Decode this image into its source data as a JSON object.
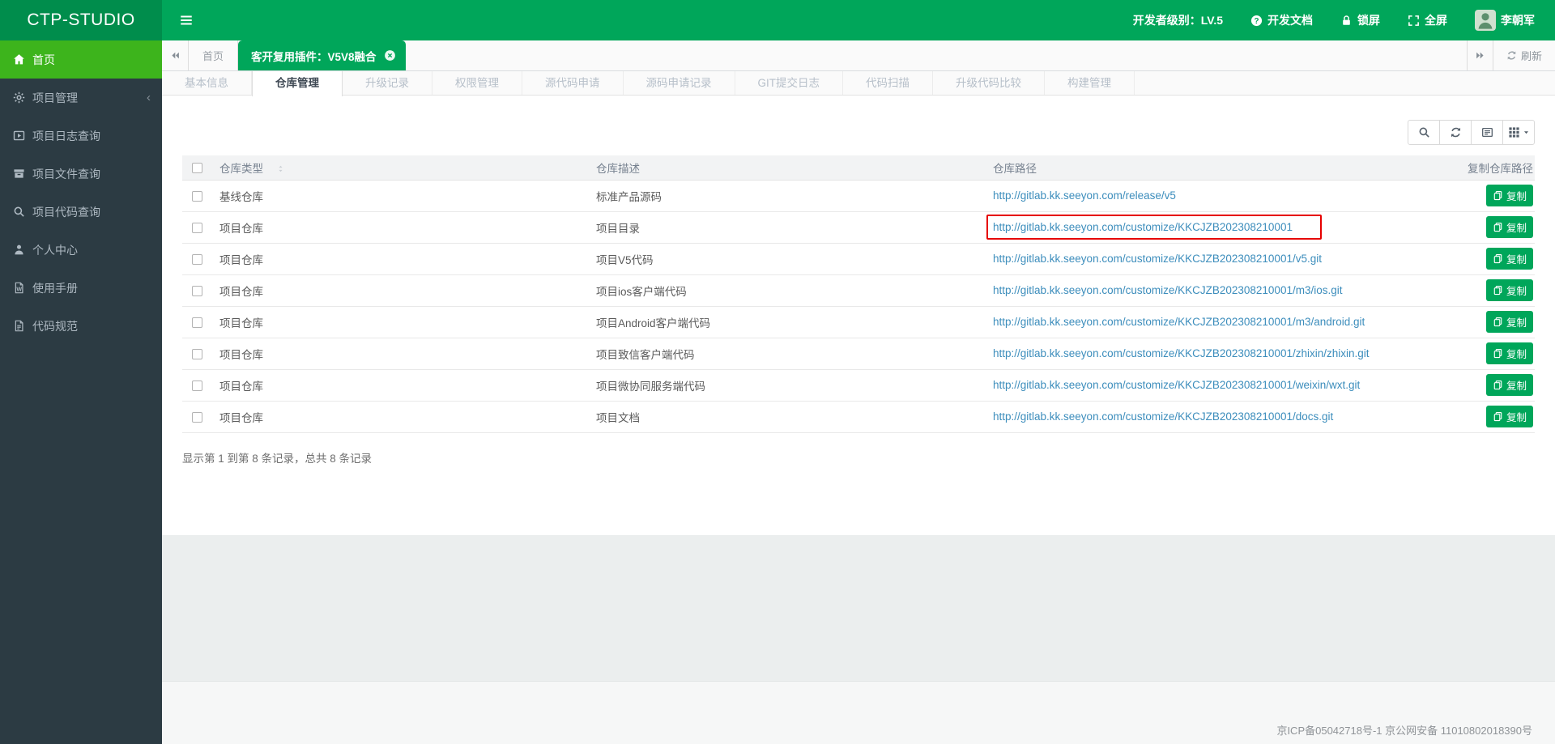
{
  "colors": {
    "primary": "#00a65a",
    "logo_bg": "#008d4c",
    "sidebar_bg": "#2c3b43",
    "sidebar_active": "#3db41c",
    "link": "#3c8dbc",
    "annotation": "#e60000"
  },
  "brand": {
    "title": "CTP-STUDIO"
  },
  "topbar": {
    "developer_level": "开发者级别：LV.5",
    "docs_label": "开发文档",
    "lock_label": "锁屏",
    "fullscreen_label": "全屏",
    "username": "李朝军"
  },
  "sidebar": {
    "items": [
      {
        "id": "home",
        "label": "首页",
        "icon": "home",
        "active": true
      },
      {
        "id": "project-manage",
        "label": "项目管理",
        "icon": "gear",
        "chevron": true
      },
      {
        "id": "project-log",
        "label": "项目日志查询",
        "icon": "log"
      },
      {
        "id": "project-file",
        "label": "项目文件查询",
        "icon": "archive"
      },
      {
        "id": "project-code",
        "label": "项目代码查询",
        "icon": "search"
      },
      {
        "id": "personal-center",
        "label": "个人中心",
        "icon": "user"
      },
      {
        "id": "user-manual",
        "label": "使用手册",
        "icon": "file-w"
      },
      {
        "id": "code-standard",
        "label": "代码规范",
        "icon": "file-text"
      }
    ]
  },
  "tabbar": {
    "tabs": [
      {
        "label": "首页",
        "active": false
      },
      {
        "label": "客开复用插件：V5V8融合",
        "active": true,
        "closable": true
      }
    ],
    "refresh_label": "刷新"
  },
  "subtabs": {
    "active": "仓库管理",
    "items": [
      "基本信息",
      "仓库管理",
      "升级记录",
      "权限管理",
      "源代码申请",
      "源码申请记录",
      "GIT提交日志",
      "代码扫描",
      "升级代码比较",
      "构建管理"
    ]
  },
  "table": {
    "columns": [
      "仓库类型",
      "仓库描述",
      "仓库路径",
      "复制仓库路径"
    ],
    "copy_label": "复制",
    "rows": [
      {
        "type": "基线仓库",
        "desc": "标准产品源码",
        "url": "http://gitlab.kk.seeyon.com/release/v5",
        "highlight": false
      },
      {
        "type": "项目仓库",
        "desc": "项目目录",
        "url": "http://gitlab.kk.seeyon.com/customize/KKCJZB202308210001",
        "highlight": true
      },
      {
        "type": "项目仓库",
        "desc": "项目V5代码",
        "url": "http://gitlab.kk.seeyon.com/customize/KKCJZB202308210001/v5.git",
        "highlight": false
      },
      {
        "type": "项目仓库",
        "desc": "项目ios客户端代码",
        "url": "http://gitlab.kk.seeyon.com/customize/KKCJZB202308210001/m3/ios.git",
        "highlight": false
      },
      {
        "type": "项目仓库",
        "desc": "项目Android客户端代码",
        "url": "http://gitlab.kk.seeyon.com/customize/KKCJZB202308210001/m3/android.git",
        "highlight": false
      },
      {
        "type": "项目仓库",
        "desc": "项目致信客户端代码",
        "url": "http://gitlab.kk.seeyon.com/customize/KKCJZB202308210001/zhixin/zhixin.git",
        "highlight": false
      },
      {
        "type": "项目仓库",
        "desc": "项目微协同服务端代码",
        "url": "http://gitlab.kk.seeyon.com/customize/KKCJZB202308210001/weixin/wxt.git",
        "highlight": false
      },
      {
        "type": "项目仓库",
        "desc": "项目文档",
        "url": "http://gitlab.kk.seeyon.com/customize/KKCJZB202308210001/docs.git",
        "highlight": false
      }
    ],
    "summary": "显示第 1 到第 8 条记录，总共 8 条记录"
  },
  "footer": {
    "icp": "京ICP备05042718号-1 京公网安备 11010802018390号"
  }
}
